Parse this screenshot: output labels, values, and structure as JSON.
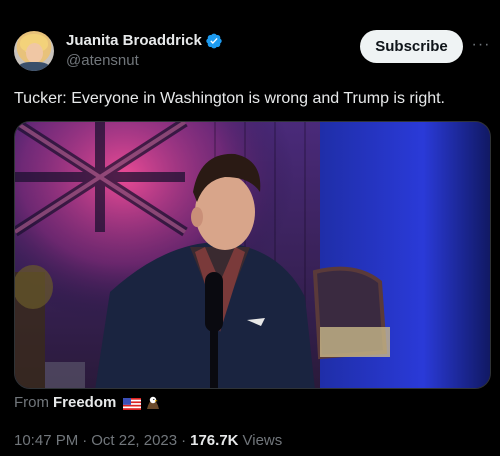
{
  "author": {
    "display_name": "Juanita Broaddrick",
    "handle": "@atensnut",
    "verified_icon": "verified-badge-icon",
    "accent_color": "#1d9bf0"
  },
  "actions": {
    "subscribe_label": "Subscribe",
    "more_label": "···"
  },
  "tweet": {
    "text": "Tucker:  Everyone in Washington is wrong and Trump is right."
  },
  "media": {
    "type": "video",
    "description_icon": "video-thumbnail"
  },
  "source": {
    "prefix": "From",
    "name": "Freedom",
    "emojis": [
      "us-flag-icon",
      "eagle-icon"
    ]
  },
  "meta": {
    "time": "10:47 PM",
    "separator1": "·",
    "date": "Oct 22, 2023",
    "separator2": "·",
    "views_count": "176.7K",
    "views_label": "Views"
  }
}
